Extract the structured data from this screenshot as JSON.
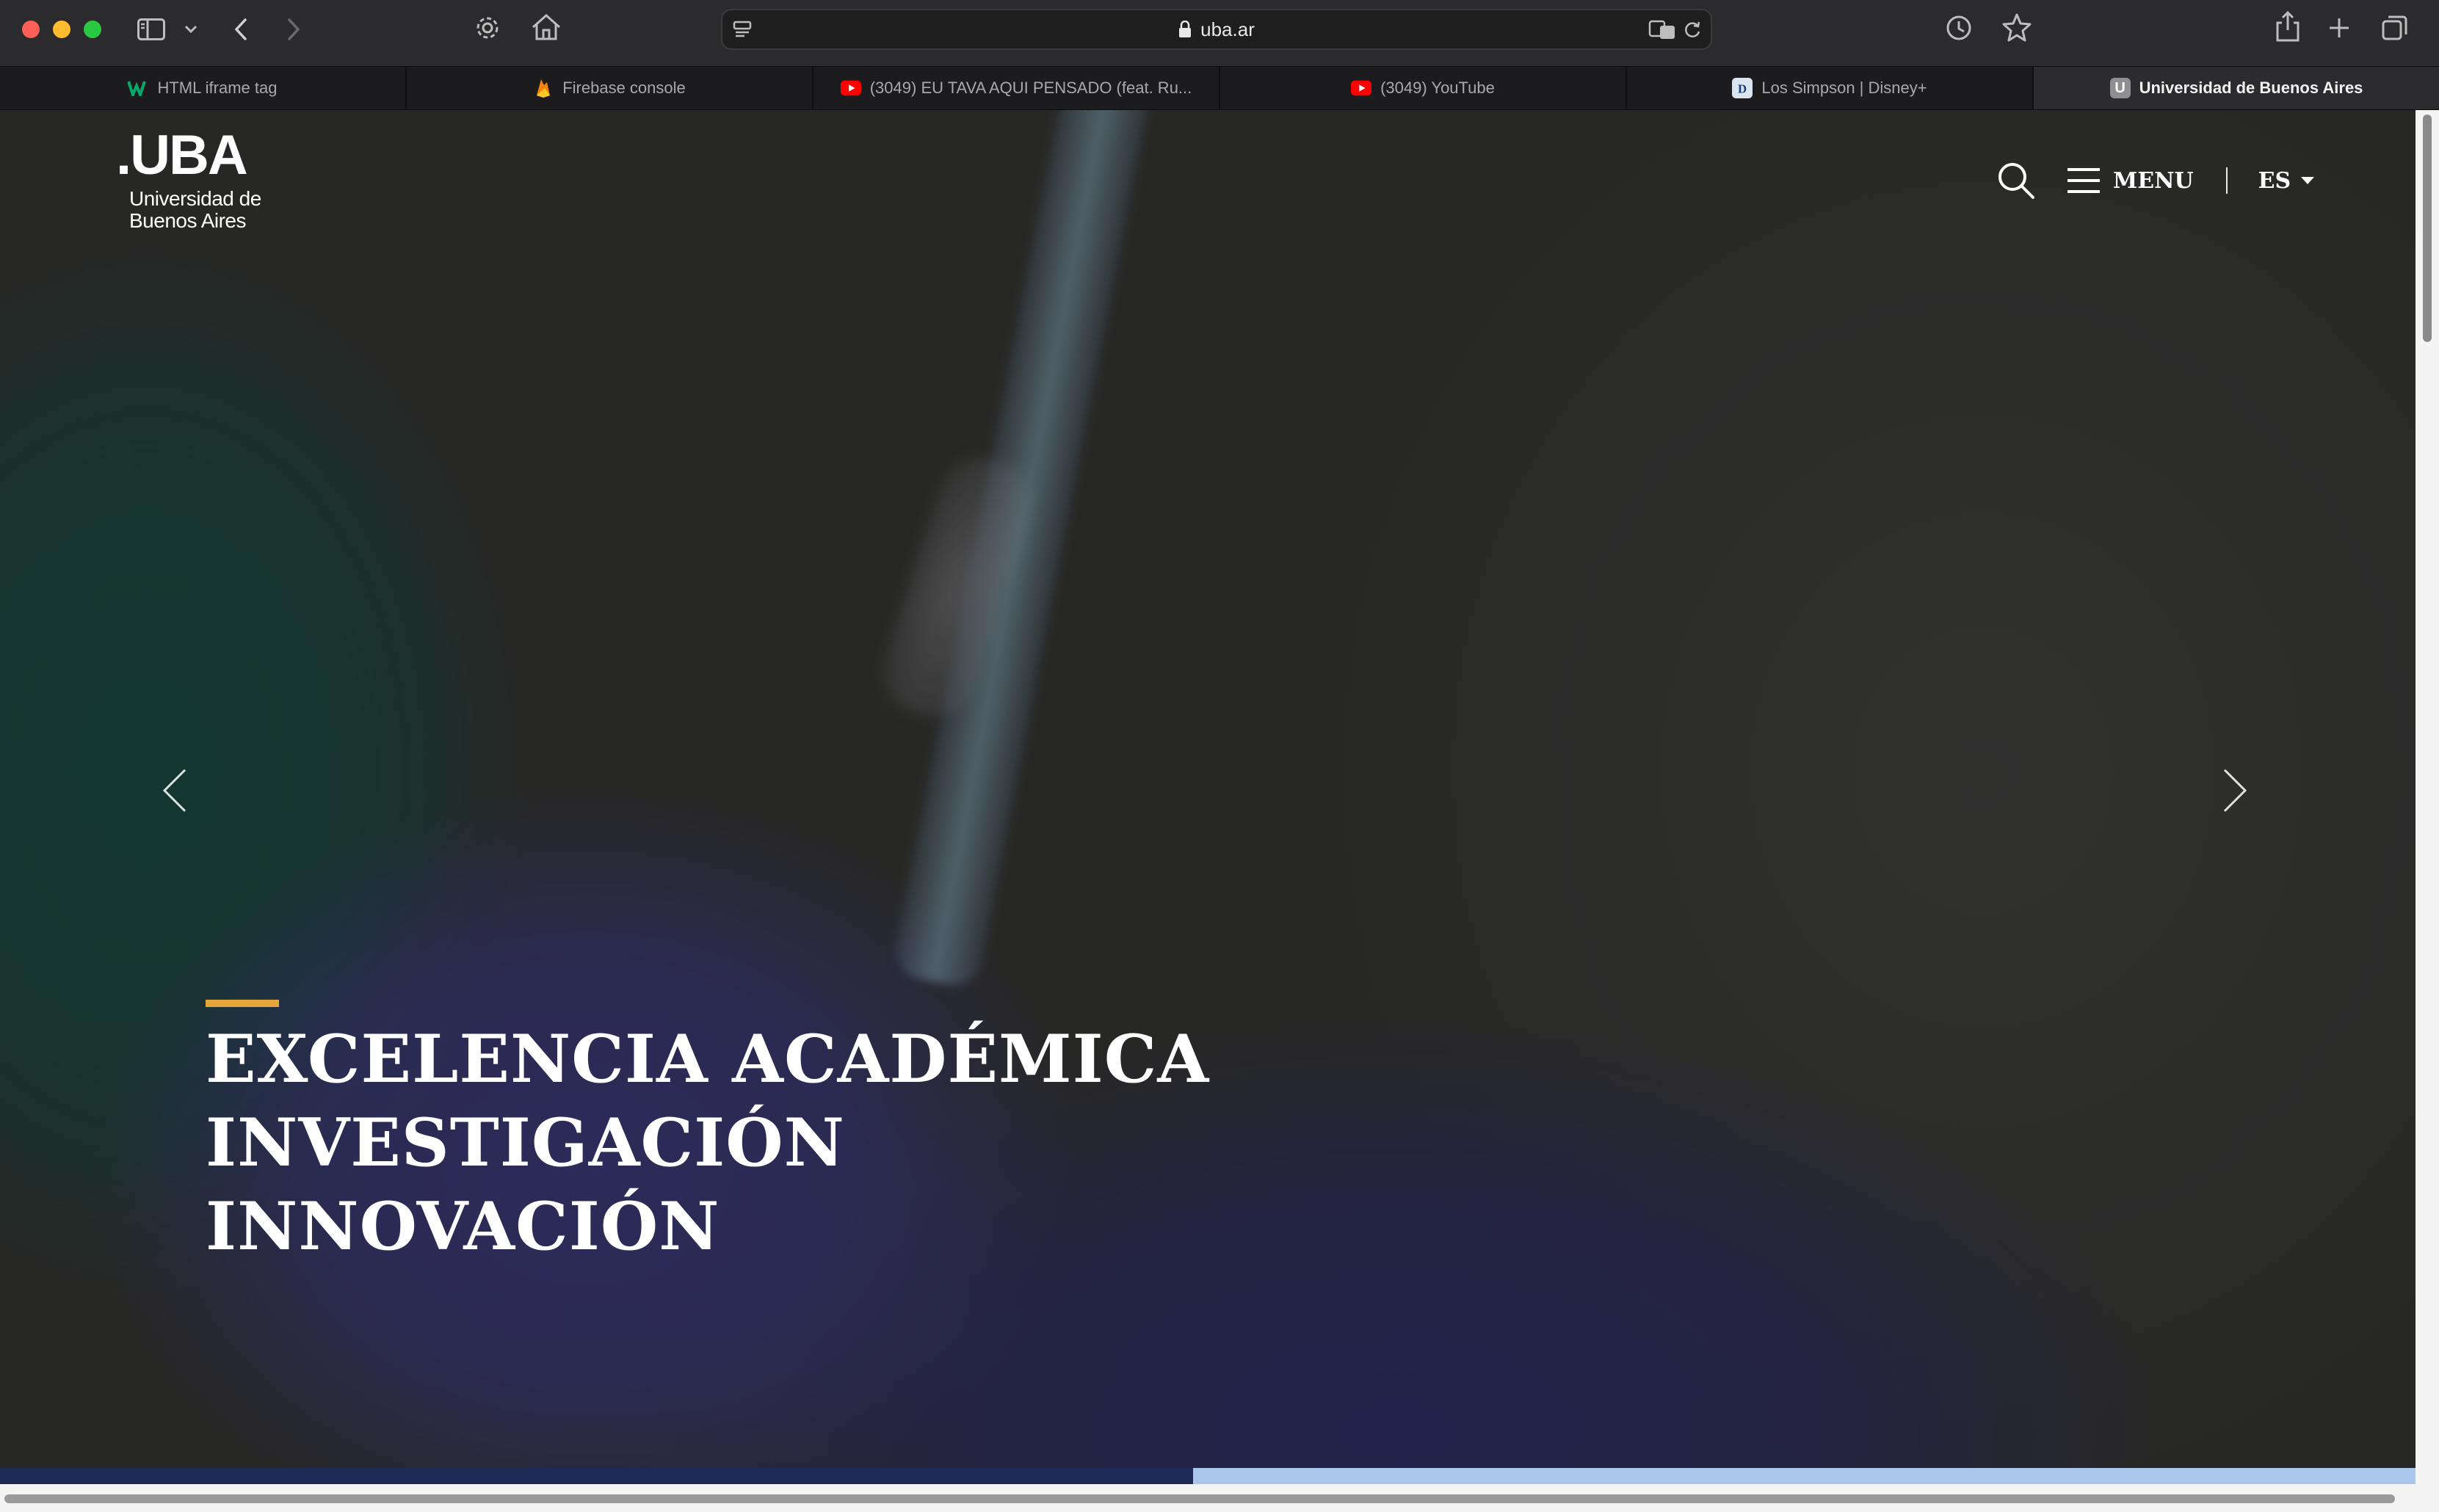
{
  "browser": {
    "url": "uba.ar",
    "tabs": [
      {
        "label": "HTML iframe tag",
        "favicon": "w3schools-icon",
        "active": false
      },
      {
        "label": "Firebase console",
        "favicon": "firebase-icon",
        "active": false
      },
      {
        "label": "(3049) EU TAVA AQUI PENSADO (feat. Ru...",
        "favicon": "youtube-icon",
        "active": false
      },
      {
        "label": "(3049) YouTube",
        "favicon": "youtube-icon",
        "active": false
      },
      {
        "label": "Los Simpson | Disney+",
        "favicon": "disney-plus-icon",
        "active": false
      },
      {
        "label": "Universidad de Buenos Aires",
        "favicon": "uba-favicon",
        "favicon_letter": "U",
        "active": true
      }
    ]
  },
  "site": {
    "logo": {
      "mark": ".UBA",
      "line1": "Universidad de",
      "line2": "Buenos Aires"
    },
    "nav": {
      "menu_label": "MENU",
      "language": "ES"
    },
    "hero": {
      "lines": [
        "EXCELENCIA ACADÉMICA",
        "INVESTIGACIÓN",
        "INNOVACIÓN"
      ],
      "accent_color": "#e6a53a"
    },
    "carousel": {
      "progress": 0.494,
      "fill_color": "#1d2955",
      "track_color": "#a9c7ea"
    }
  },
  "colors": {
    "traffic_red": "#fe5f57",
    "traffic_yellow": "#febc2e",
    "traffic_green": "#28c840"
  }
}
